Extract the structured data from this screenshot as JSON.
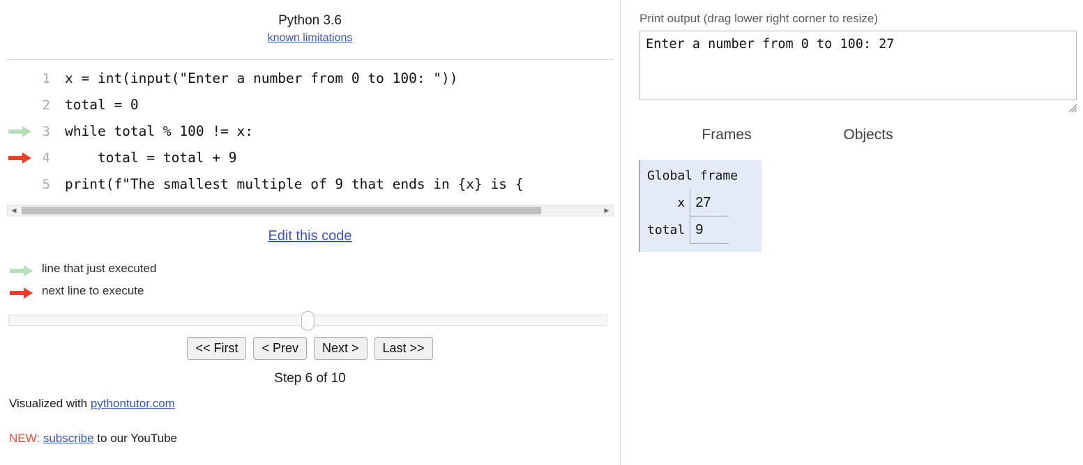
{
  "language": {
    "title": "Python 3.6",
    "limitations_link": "known limitations"
  },
  "code": {
    "lines": [
      {
        "number": "1",
        "text": "x = int(input(\"Enter a number from 0 to 100: \"))",
        "marker": "none"
      },
      {
        "number": "2",
        "text": "total = 0",
        "marker": "none"
      },
      {
        "number": "3",
        "text": "while total % 100 != x:",
        "marker": "executed"
      },
      {
        "number": "4",
        "text": "    total = total + 9",
        "marker": "next"
      },
      {
        "number": "5",
        "text": "print(f\"The smallest multiple of 9 that ends in {x} is {",
        "marker": "none"
      }
    ]
  },
  "edit_link": "Edit this code",
  "legend": [
    {
      "label": "line that just executed",
      "marker": "executed"
    },
    {
      "label": "next line to execute",
      "marker": "next"
    }
  ],
  "controls": {
    "first": "<< First",
    "prev": "< Prev",
    "next": "Next >",
    "last": "Last >>",
    "step_label": "Step 6 of 10",
    "step_current": 6,
    "step_total": 10
  },
  "footer": {
    "credit_prefix": "Visualized with ",
    "credit_link": "pythontutor.com",
    "new_tag": "NEW: ",
    "subscribe_link": "subscribe",
    "new_suffix": " to our YouTube"
  },
  "output": {
    "label": "Print output (drag lower right corner to resize)",
    "value": "Enter a number from 0 to 100: 27"
  },
  "visualization": {
    "frames_header": "Frames",
    "objects_header": "Objects",
    "frames": [
      {
        "title": "Global frame",
        "variables": [
          {
            "name": "x",
            "value": "27"
          },
          {
            "name": "total",
            "value": "9"
          }
        ]
      }
    ]
  },
  "colors": {
    "executed_arrow": "#b5e2b5",
    "next_arrow": "#ec3d2b",
    "link": "#3a53c4",
    "frame_bg": "#e2ebf7",
    "new_tag": "#e8503a"
  }
}
